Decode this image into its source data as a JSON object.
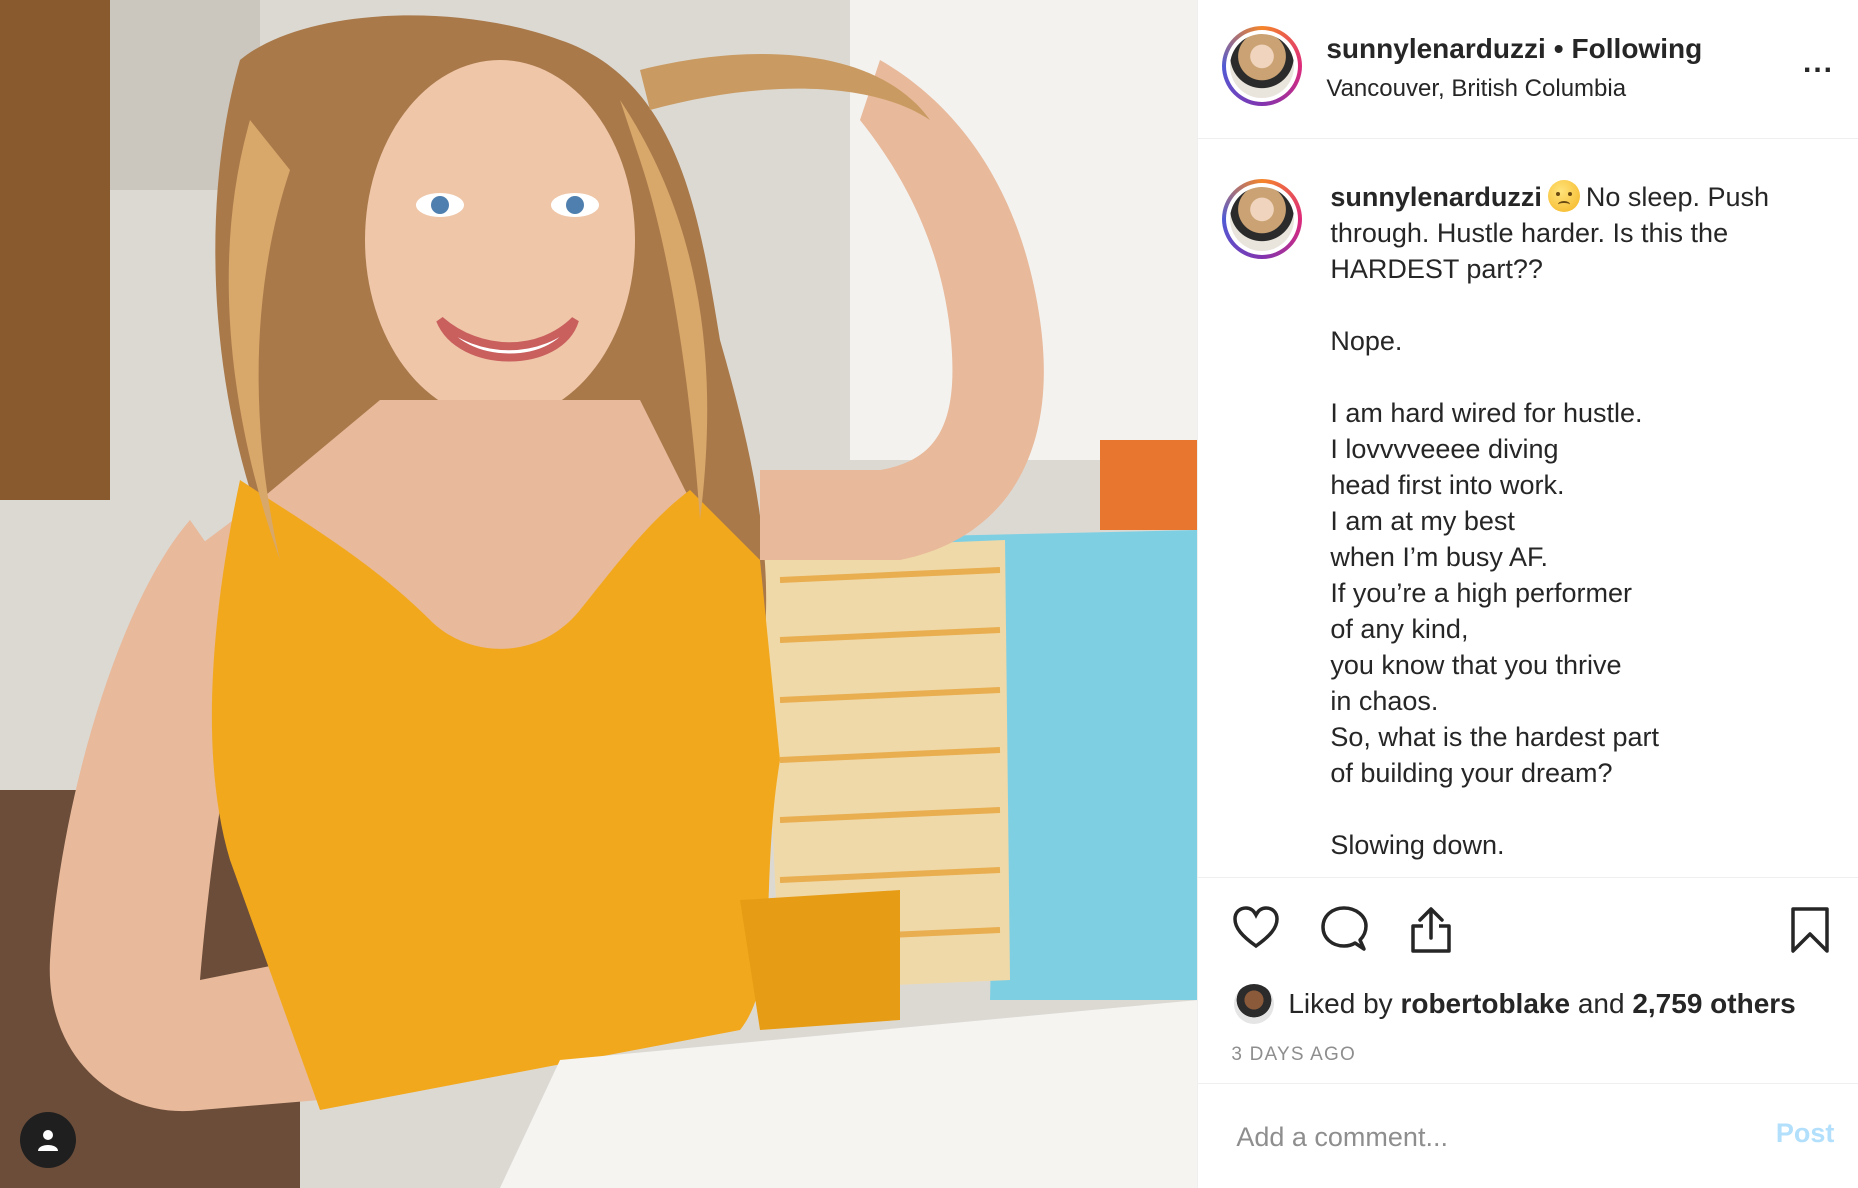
{
  "header": {
    "username": "sunnylenarduzzi",
    "separator": "•",
    "follow_status": "Following",
    "location": "Vancouver, British Columbia",
    "more_label": "..."
  },
  "caption": {
    "username": "sunnylenarduzzi",
    "emoji": "😥",
    "text": "No sleep. Push\nthrough. Hustle harder. Is this the\nHARDEST part??\n\nNope.\n\nI am hard wired for hustle.\nI lovvvveeee diving\nhead first into work.\nI am at my best\nwhen I’m busy AF.\nIf you’re a high performer\nof any kind,\nyou know that you thrive\nin chaos.\nSo, what is the hardest part\nof building your dream?\n\nSlowing down."
  },
  "actions": {
    "like_icon": "heart-icon",
    "comment_icon": "comment-icon",
    "share_icon": "share-icon",
    "save_icon": "bookmark-icon"
  },
  "likes": {
    "prefix": "Liked by",
    "liker": "robertoblake",
    "conjunction": "and",
    "others": "2,759 others"
  },
  "timestamp": "3 DAYS AGO",
  "comment": {
    "placeholder": "Add a comment...",
    "post_label": "Post"
  },
  "colors": {
    "accent_blue_disabled": "#b2dffc",
    "muted_text": "#8e8e8e",
    "divider": "#efefef",
    "top_color": "#f2a81d"
  }
}
